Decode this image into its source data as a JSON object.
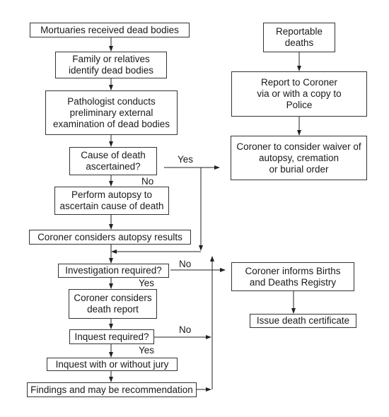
{
  "diagram": {
    "nodes": {
      "mortuaries": "Mortuaries received dead bodies",
      "family_identify": "Family or relatives\nidentify dead bodies",
      "pathologist": "Pathologist conducts\npreliminary external\nexamination of dead bodies",
      "cause_ascertained": "Cause of death\nascertained?",
      "perform_autopsy": "Perform autopsy to\nascertain cause of death",
      "coroner_autopsy_results": "Coroner considers autopsy results",
      "investigation_required": "Investigation required?",
      "coroner_death_report": "Coroner considers\ndeath report",
      "inquest_required": "Inquest required?",
      "inquest_jury": "Inquest with or without jury",
      "findings": "Findings and may be recommendation",
      "reportable_deaths": "Reportable\ndeaths",
      "report_to_coroner": "Report to Coroner\nvia or with a copy to\nPolice",
      "coroner_waiver": "Coroner to consider waiver of\nautopsy, cremation\nor burial order",
      "coroner_informs_registry": "Coroner informs Births\nand Deaths Registry",
      "issue_certificate": "Issue death certificate"
    },
    "edge_labels": {
      "cause_yes": "Yes",
      "cause_no": "No",
      "investigation_no": "No",
      "investigation_yes": "Yes",
      "inquest_no": "No",
      "inquest_yes": "Yes"
    }
  }
}
